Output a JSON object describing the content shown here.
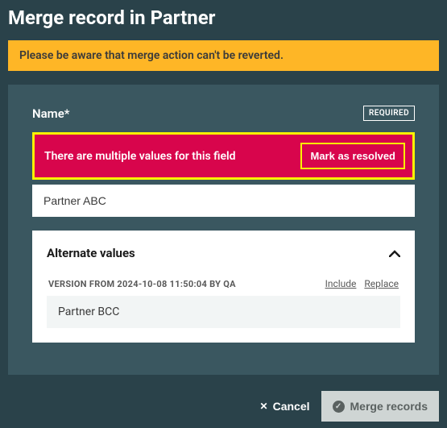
{
  "title": "Merge record in Partner",
  "warning": "Please be aware that merge action can't be reverted.",
  "field": {
    "label": "Name*",
    "required_badge": "REQUIRED",
    "conflict_message": "There are multiple values for this field",
    "resolve_label": "Mark as resolved",
    "value": "Partner ABC"
  },
  "alternate": {
    "title": "Alternate values",
    "version_label": "VERSION FROM 2024-10-08 11:50:04 BY QA",
    "include_label": "Include",
    "replace_label": "Replace",
    "value": "Partner BCC"
  },
  "footer": {
    "cancel_label": "Cancel",
    "merge_label": "Merge records"
  }
}
